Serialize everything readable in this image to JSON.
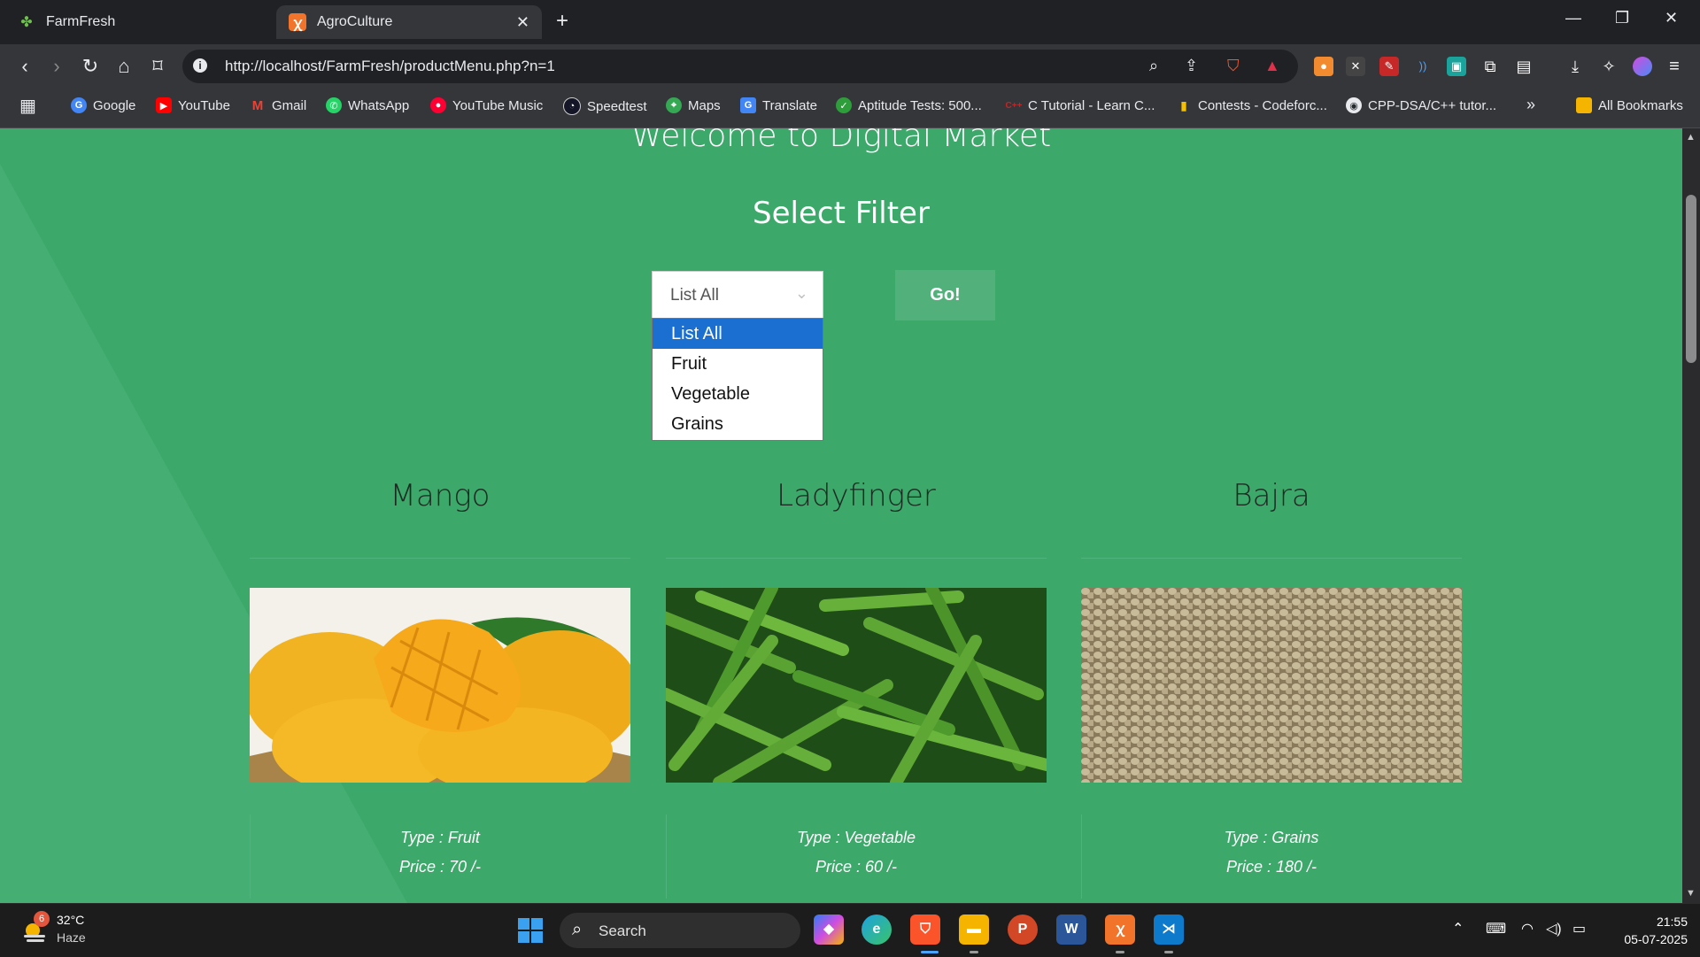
{
  "browser": {
    "tabs": [
      {
        "label": "FarmFresh",
        "active": false,
        "icon": "clover-icon"
      },
      {
        "label": "AgroCulture",
        "active": true,
        "icon": "xampp-icon"
      }
    ],
    "url": "http://localhost/FarmFresh/productMenu.php?n=1",
    "bookmarks": [
      {
        "label": "Google",
        "color": "#4285f4"
      },
      {
        "label": "YouTube",
        "color": "#ff0000"
      },
      {
        "label": "Gmail",
        "color": "#ea4335"
      },
      {
        "label": "WhatsApp",
        "color": "#25d366"
      },
      {
        "label": "YouTube Music",
        "color": "#ff0033"
      },
      {
        "label": "Speedtest",
        "color": "#141526"
      },
      {
        "label": "Maps",
        "color": "#34a853"
      },
      {
        "label": "Translate",
        "color": "#4285f4"
      },
      {
        "label": "Aptitude Tests: 500...",
        "color": "#2e9e3a"
      },
      {
        "label": "C Tutorial - Learn C...",
        "color": "#cc2222"
      },
      {
        "label": "Contests - Codeforc...",
        "color": "#1f8acb"
      },
      {
        "label": "CPP-DSA/C++ tutor...",
        "color": "#24292e"
      }
    ],
    "all_bookmarks": "All Bookmarks"
  },
  "page": {
    "welcome": "Welcome to Digital Market",
    "filter_title": "Select Filter",
    "select_value": "List All",
    "options": [
      "List All",
      "Fruit",
      "Vegetable",
      "Grains"
    ],
    "selected_option": "List All",
    "go_label": "Go!",
    "products": [
      {
        "name": "Mango",
        "type": "Type : Fruit",
        "price": "Price : 70 /-"
      },
      {
        "name": "Ladyfinger",
        "type": "Type : Vegetable",
        "price": "Price : 60 /-"
      },
      {
        "name": "Bajra",
        "type": "Type : Grains",
        "price": "Price : 180 /-"
      }
    ]
  },
  "colors": {
    "page_green": "#3ca86a",
    "select_highlight": "#1a6fd0",
    "go_button": "#52b17b"
  },
  "taskbar": {
    "weather_temp": "32°C",
    "weather_desc": "Haze",
    "weather_badge": "6",
    "search_placeholder": "Search",
    "time": "21:55",
    "date": "05-07-2025"
  }
}
